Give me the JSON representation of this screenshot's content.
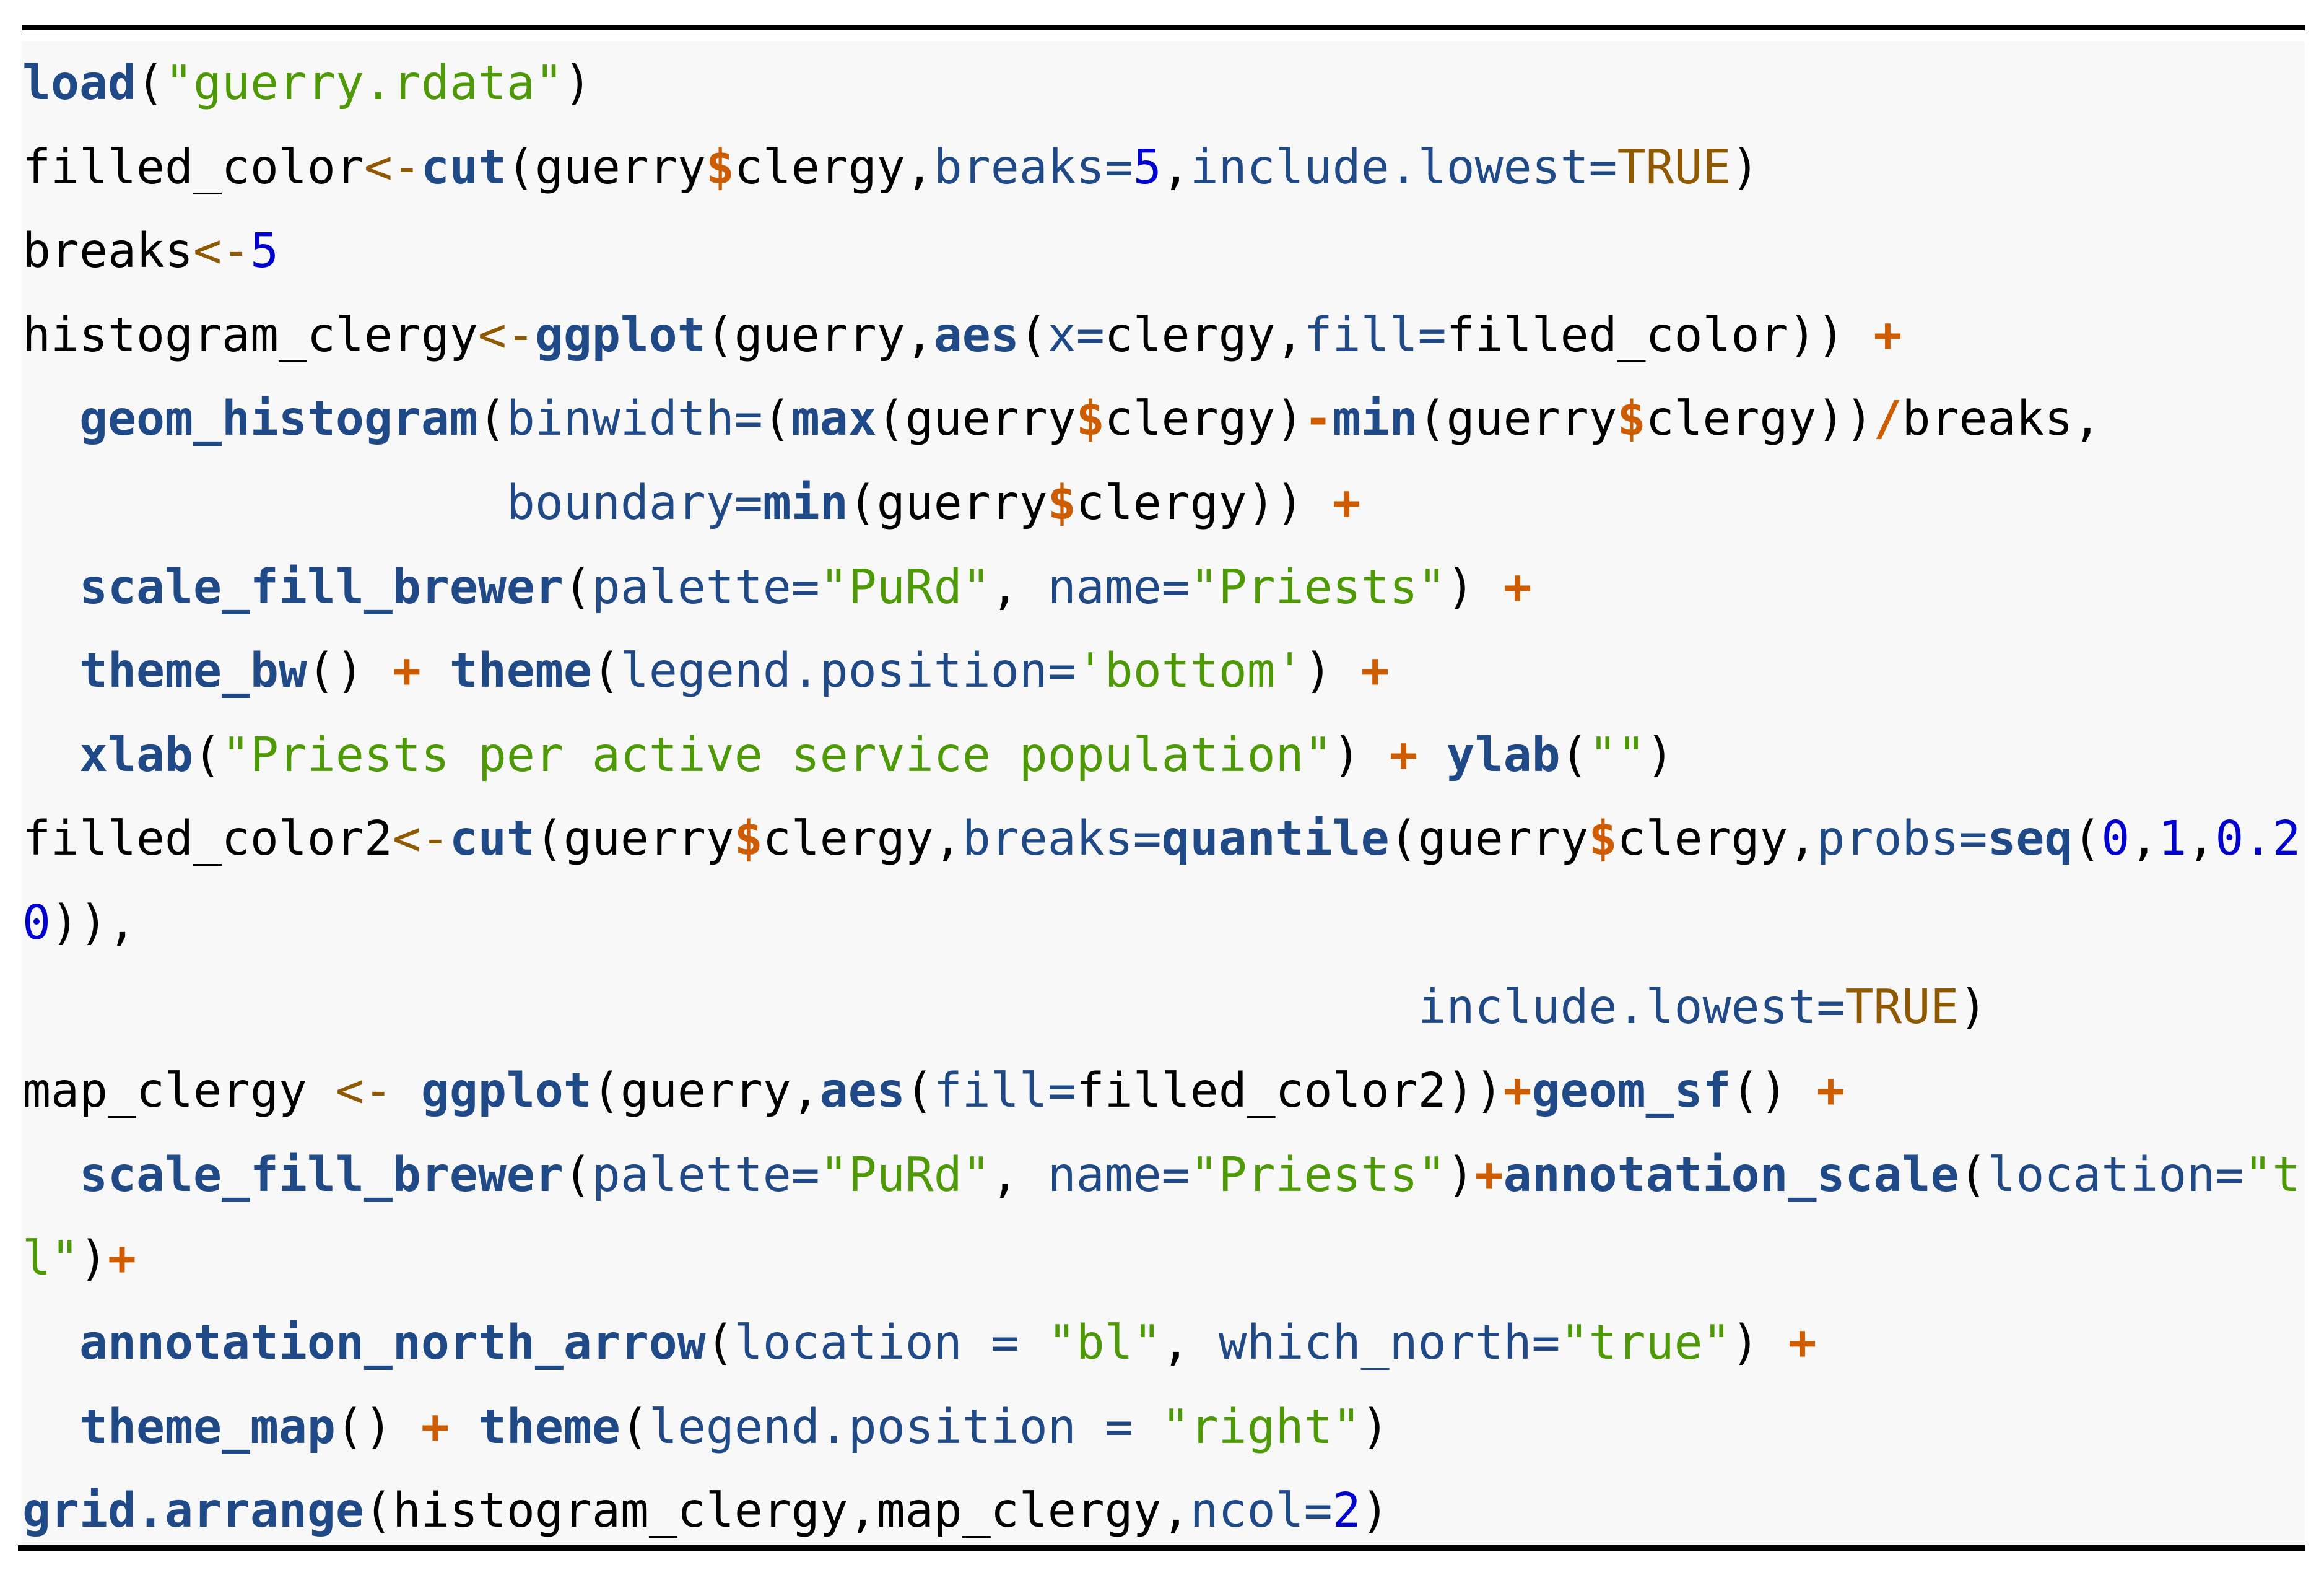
{
  "document": {
    "kind": "code-listing",
    "language": "R",
    "highlight_colors": {
      "function": "#204a87",
      "argument": "#204a87",
      "string": "#4e9a06",
      "number": "#0000cf",
      "operator": "#ce5c00",
      "assignment": "#8f5902",
      "constant": "#8f5902",
      "plain": "#000000",
      "background": "#f8f8f8"
    },
    "lines": [
      [
        [
          "fn",
          "load"
        ],
        [
          "plain",
          "("
        ],
        [
          "str",
          "\"guerry.rdata\""
        ],
        [
          "plain",
          ")"
        ]
      ],
      [
        [
          "plain",
          "filled_color"
        ],
        [
          "assign",
          "<-"
        ],
        [
          "fn",
          "cut"
        ],
        [
          "plain",
          "(guerry"
        ],
        [
          "op",
          "$"
        ],
        [
          "plain",
          "clergy,"
        ],
        [
          "arg",
          "breaks="
        ],
        [
          "num",
          "5"
        ],
        [
          "plain",
          ","
        ],
        [
          "arg",
          "include.lowest="
        ],
        [
          "const",
          "TRUE"
        ],
        [
          "plain",
          ")"
        ]
      ],
      [
        [
          "plain",
          "breaks"
        ],
        [
          "assign",
          "<-"
        ],
        [
          "num",
          "5"
        ]
      ],
      [
        [
          "plain",
          "histogram_clergy"
        ],
        [
          "assign",
          "<-"
        ],
        [
          "fn",
          "ggplot"
        ],
        [
          "plain",
          "(guerry,"
        ],
        [
          "fn",
          "aes"
        ],
        [
          "plain",
          "("
        ],
        [
          "arg",
          "x="
        ],
        [
          "plain",
          "clergy,"
        ],
        [
          "arg",
          "fill="
        ],
        [
          "plain",
          "filled_color)) "
        ],
        [
          "op",
          "+"
        ]
      ],
      [
        [
          "plain",
          "  "
        ],
        [
          "fn",
          "geom_histogram"
        ],
        [
          "plain",
          "("
        ],
        [
          "arg",
          "binwidth="
        ],
        [
          "plain",
          "("
        ],
        [
          "fn",
          "max"
        ],
        [
          "plain",
          "(guerry"
        ],
        [
          "op",
          "$"
        ],
        [
          "plain",
          "clergy)"
        ],
        [
          "op",
          "-"
        ],
        [
          "fn",
          "min"
        ],
        [
          "plain",
          "(guerry"
        ],
        [
          "op",
          "$"
        ],
        [
          "plain",
          "clergy))"
        ],
        [
          "op",
          "/"
        ],
        [
          "plain",
          "breaks,"
        ]
      ],
      [
        [
          "plain",
          "                 "
        ],
        [
          "arg",
          "boundary="
        ],
        [
          "fn",
          "min"
        ],
        [
          "plain",
          "(guerry"
        ],
        [
          "op",
          "$"
        ],
        [
          "plain",
          "clergy)) "
        ],
        [
          "op",
          "+"
        ]
      ],
      [
        [
          "plain",
          "  "
        ],
        [
          "fn",
          "scale_fill_brewer"
        ],
        [
          "plain",
          "("
        ],
        [
          "arg",
          "palette="
        ],
        [
          "str",
          "\"PuRd\""
        ],
        [
          "plain",
          ", "
        ],
        [
          "arg",
          "name="
        ],
        [
          "str",
          "\"Priests\""
        ],
        [
          "plain",
          ") "
        ],
        [
          "op",
          "+"
        ]
      ],
      [
        [
          "plain",
          "  "
        ],
        [
          "fn",
          "theme_bw"
        ],
        [
          "plain",
          "() "
        ],
        [
          "op",
          "+"
        ],
        [
          "plain",
          " "
        ],
        [
          "fn",
          "theme"
        ],
        [
          "plain",
          "("
        ],
        [
          "arg",
          "legend.position="
        ],
        [
          "str",
          "'bottom'"
        ],
        [
          "plain",
          ") "
        ],
        [
          "op",
          "+"
        ]
      ],
      [
        [
          "plain",
          "  "
        ],
        [
          "fn",
          "xlab"
        ],
        [
          "plain",
          "("
        ],
        [
          "str",
          "\"Priests per active service population\""
        ],
        [
          "plain",
          ") "
        ],
        [
          "op",
          "+"
        ],
        [
          "plain",
          " "
        ],
        [
          "fn",
          "ylab"
        ],
        [
          "plain",
          "("
        ],
        [
          "str",
          "\"\""
        ],
        [
          "plain",
          ")"
        ]
      ],
      [
        [
          "plain",
          "filled_color2"
        ],
        [
          "assign",
          "<-"
        ],
        [
          "fn",
          "cut"
        ],
        [
          "plain",
          "(guerry"
        ],
        [
          "op",
          "$"
        ],
        [
          "plain",
          "clergy,"
        ],
        [
          "arg",
          "breaks="
        ],
        [
          "fn",
          "quantile"
        ],
        [
          "plain",
          "(guerry"
        ],
        [
          "op",
          "$"
        ],
        [
          "plain",
          "clergy,"
        ],
        [
          "arg",
          "probs="
        ],
        [
          "fn",
          "seq"
        ],
        [
          "plain",
          "("
        ],
        [
          "num",
          "0"
        ],
        [
          "plain",
          ","
        ],
        [
          "num",
          "1"
        ],
        [
          "plain",
          ","
        ],
        [
          "num",
          "0.2"
        ]
      ],
      [
        [
          "num",
          "0"
        ],
        [
          "plain",
          ")),"
        ]
      ],
      [
        [
          "plain",
          "                                                 "
        ],
        [
          "arg",
          "include.lowest="
        ],
        [
          "const",
          "TRUE"
        ],
        [
          "plain",
          ")"
        ]
      ],
      [
        [
          "plain",
          "map_clergy "
        ],
        [
          "assign",
          "<-"
        ],
        [
          "plain",
          " "
        ],
        [
          "fn",
          "ggplot"
        ],
        [
          "plain",
          "(guerry,"
        ],
        [
          "fn",
          "aes"
        ],
        [
          "plain",
          "("
        ],
        [
          "arg",
          "fill="
        ],
        [
          "plain",
          "filled_color2))"
        ],
        [
          "op",
          "+"
        ],
        [
          "fn",
          "geom_sf"
        ],
        [
          "plain",
          "() "
        ],
        [
          "op",
          "+"
        ]
      ],
      [
        [
          "plain",
          "  "
        ],
        [
          "fn",
          "scale_fill_brewer"
        ],
        [
          "plain",
          "("
        ],
        [
          "arg",
          "palette="
        ],
        [
          "str",
          "\"PuRd\""
        ],
        [
          "plain",
          ", "
        ],
        [
          "arg",
          "name="
        ],
        [
          "str",
          "\"Priests\""
        ],
        [
          "plain",
          ")"
        ],
        [
          "op",
          "+"
        ],
        [
          "fn",
          "annotation_scale"
        ],
        [
          "plain",
          "("
        ],
        [
          "arg",
          "location="
        ],
        [
          "str",
          "\"t"
        ]
      ],
      [
        [
          "str",
          "l\""
        ],
        [
          "plain",
          ")"
        ],
        [
          "op",
          "+"
        ]
      ],
      [
        [
          "plain",
          "  "
        ],
        [
          "fn",
          "annotation_north_arrow"
        ],
        [
          "plain",
          "("
        ],
        [
          "arg",
          "location = "
        ],
        [
          "str",
          "\"bl\""
        ],
        [
          "plain",
          ", "
        ],
        [
          "arg",
          "which_north="
        ],
        [
          "str",
          "\"true\""
        ],
        [
          "plain",
          ") "
        ],
        [
          "op",
          "+"
        ]
      ],
      [
        [
          "plain",
          "  "
        ],
        [
          "fn",
          "theme_map"
        ],
        [
          "plain",
          "() "
        ],
        [
          "op",
          "+"
        ],
        [
          "plain",
          " "
        ],
        [
          "fn",
          "theme"
        ],
        [
          "plain",
          "("
        ],
        [
          "arg",
          "legend.position = "
        ],
        [
          "str",
          "\"right\""
        ],
        [
          "plain",
          ")"
        ]
      ],
      [
        [
          "fn",
          "grid.arrange"
        ],
        [
          "plain",
          "(histogram_clergy,map_clergy,"
        ],
        [
          "arg",
          "ncol="
        ],
        [
          "num",
          "2"
        ],
        [
          "plain",
          ")"
        ]
      ]
    ]
  }
}
